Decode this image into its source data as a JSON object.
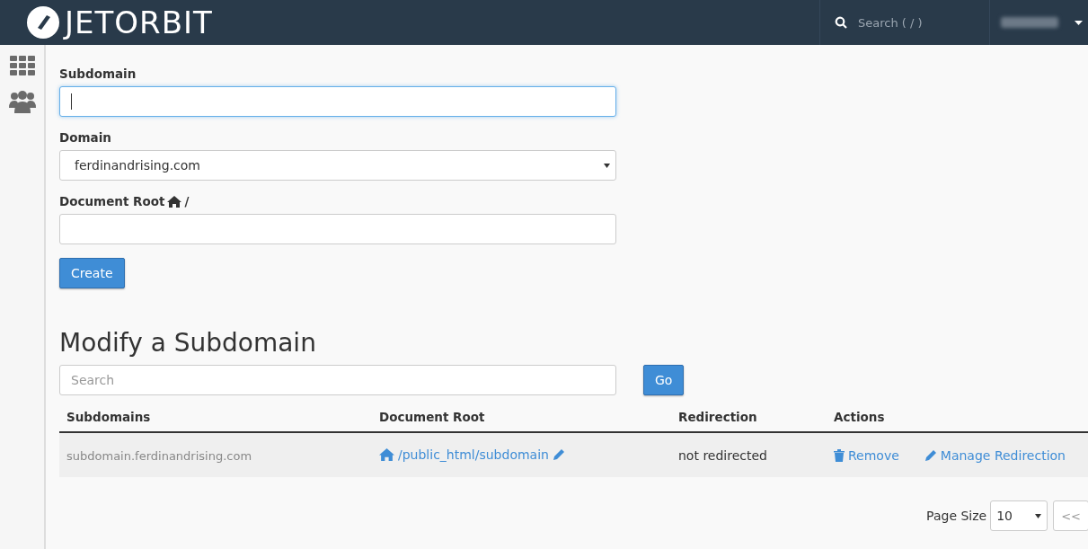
{
  "header": {
    "logo": "JETORBIT",
    "search": {
      "placeholder": "Search ( / )"
    }
  },
  "sidebar": {
    "items": [
      {
        "kind": "grid"
      },
      {
        "kind": "users"
      }
    ]
  },
  "create": {
    "fields": [
      {
        "kind": "input",
        "label": "Subdomain",
        "focused": true
      },
      {
        "kind": "select",
        "label": "Domain",
        "value": "ferdinandrising.com",
        "focused": false
      },
      {
        "kind": "root",
        "label": "Document Root",
        "suffix": "/",
        "focused": false
      }
    ],
    "button": "Create"
  },
  "modify": {
    "title": "Modify a Subdomain",
    "search": {
      "placeholder": "Search"
    },
    "go": "Go",
    "columns": [
      "Subdomains",
      "Document Root",
      "Redirection",
      "Actions"
    ],
    "rows": [
      {
        "subdomain": "subdomain.ferdinandrising.com",
        "root": "/public_html/subdomain",
        "redirection": "not redirected",
        "actions": [
          "Remove",
          "Manage Redirection"
        ]
      }
    ],
    "page_size_label": "Page Size",
    "page_size": "10",
    "prev": "<<"
  }
}
